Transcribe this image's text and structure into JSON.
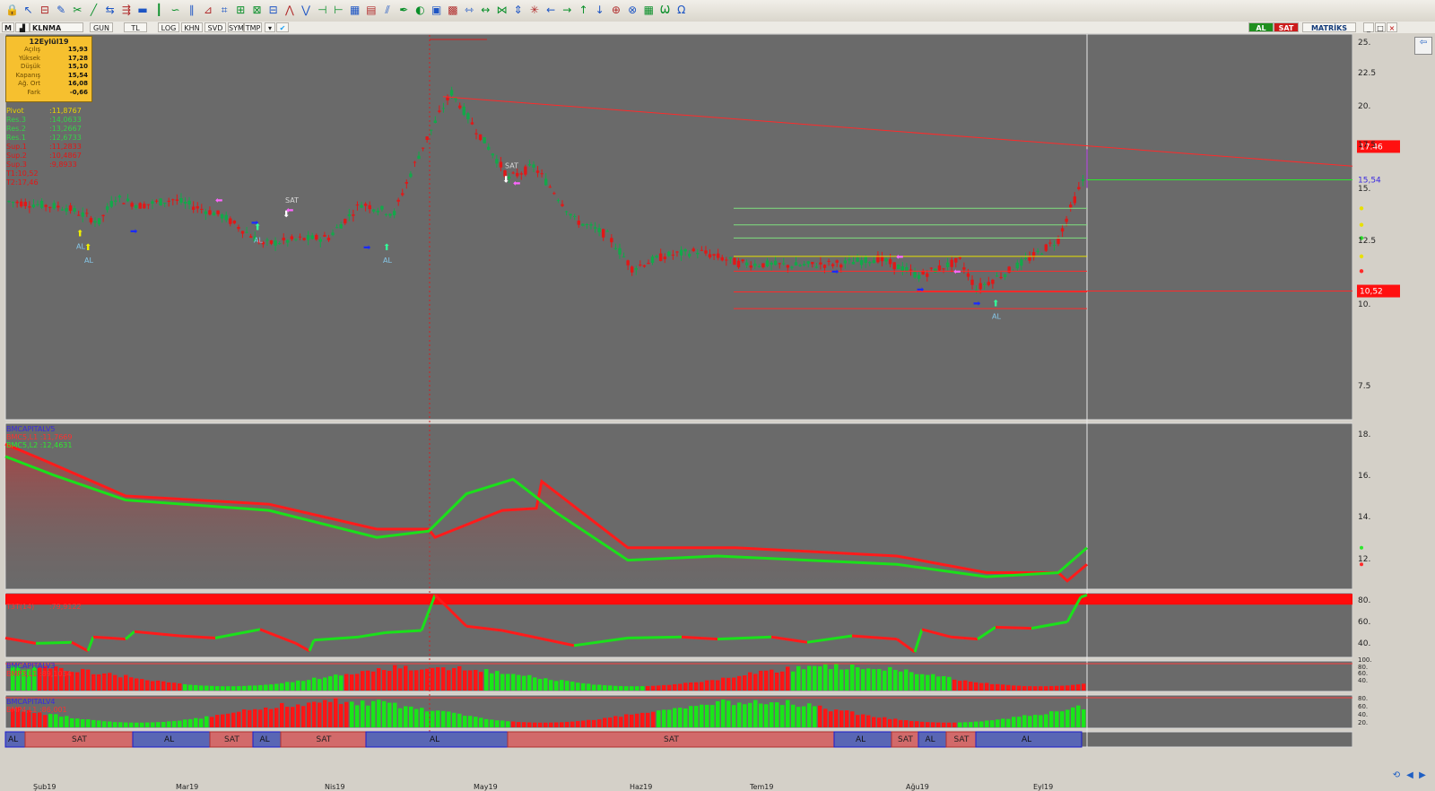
{
  "window": {
    "symbol": "KLNMA",
    "brand": "MATRİKS",
    "menu_items": [
      "GUN",
      "TL",
      "LOG",
      "KHN",
      "SVD",
      "SYM",
      "TMP"
    ],
    "al_label": "AL",
    "sat_label": "SAT"
  },
  "colors": {
    "background": "#6a6a6a",
    "bull": "#13a84a",
    "bear": "#e21717",
    "green_line": "#1be01b",
    "red_line": "#ff1b1b",
    "quote_box": "#f6c02f",
    "price_tag_red": "#ff1010"
  },
  "quote": {
    "date": "12Eylül19",
    "rows": [
      {
        "label": "Açılış",
        "value": "15,93"
      },
      {
        "label": "Yüksek",
        "value": "17,28"
      },
      {
        "label": "Düşük",
        "value": "15,10"
      },
      {
        "label": "Kapanış",
        "value": "15,54"
      },
      {
        "label": "Ağ. Ort",
        "value": "16,08"
      },
      {
        "label": "Fark",
        "value": "-0,66"
      }
    ]
  },
  "pivot": [
    {
      "name": "Pivot",
      "value": ":11,8767",
      "color": "#e8d400"
    },
    {
      "name": "Res.3",
      "value": ":14,0633",
      "color": "#36d24a"
    },
    {
      "name": "Res.2",
      "value": ":13,2667",
      "color": "#36d24a"
    },
    {
      "name": "Res.1",
      "value": ":12,6733",
      "color": "#36d24a"
    },
    {
      "name": "Sup.1",
      "value": ":11,2833",
      "color": "#e21717"
    },
    {
      "name": "Sup.2",
      "value": ":10,4867",
      "color": "#e21717"
    },
    {
      "name": "Sup.3",
      "value": ":9,8933",
      "color": "#e21717"
    },
    {
      "name": "T1:10,52",
      "value": "",
      "color": "#e21717"
    },
    {
      "name": "T2:17,46",
      "value": "",
      "color": "#e21717"
    }
  ],
  "price_axis": [
    "25.",
    "22.5",
    "20.",
    "17.5",
    "15.",
    "12.5",
    "10.",
    "7.5"
  ],
  "price_tags": {
    "top": "17.46",
    "last": "15,54",
    "bottom": "10,52"
  },
  "signals_text": {
    "al": "AL",
    "sat": "SAT"
  },
  "ind1": {
    "name": "BMCAPITALV5",
    "lines": [
      {
        "text": "BMC5,L1   :11,7669",
        "color": "#ff3030"
      },
      {
        "text": "BMC5,L2   :12,4631",
        "color": "#2ee82e"
      }
    ],
    "axis": [
      "18.",
      "16.",
      "14.",
      "12."
    ]
  },
  "ind2": {
    "name": "T3T(14)",
    "value": ":79,9122",
    "axis": [
      "80.",
      "60.",
      "40."
    ]
  },
  "ind3": {
    "name": "BMCAPITALV3",
    "value_line": "BMP3,L1   :89,1034",
    "axis": [
      "100.",
      "80.",
      "60.",
      "40."
    ]
  },
  "ind4": {
    "name": "BMCAPITALV4",
    "value_line": "BMP4,L1   :86,001",
    "axis": [
      "80.",
      "60.",
      "40.",
      "20."
    ]
  },
  "signal_band": [
    {
      "label": "AL",
      "type": "al"
    },
    {
      "label": "SAT",
      "type": "sat"
    },
    {
      "label": "AL",
      "type": "al"
    },
    {
      "label": "SAT",
      "type": "sat"
    },
    {
      "label": "AL",
      "type": "al"
    },
    {
      "label": "SAT",
      "type": "sat"
    },
    {
      "label": "AL",
      "type": "al"
    },
    {
      "label": "SAT",
      "type": "sat"
    },
    {
      "label": "AL",
      "type": "al"
    },
    {
      "label": "SAT",
      "type": "sat"
    },
    {
      "label": "AL",
      "type": "al"
    },
    {
      "label": "SAT",
      "type": "sat"
    },
    {
      "label": "AL",
      "type": "al"
    }
  ],
  "dates": [
    "Şub19",
    "Mar19",
    "Nis19",
    "May19",
    "Haz19",
    "Tem19",
    "Ağu19",
    "Eyl19"
  ]
}
